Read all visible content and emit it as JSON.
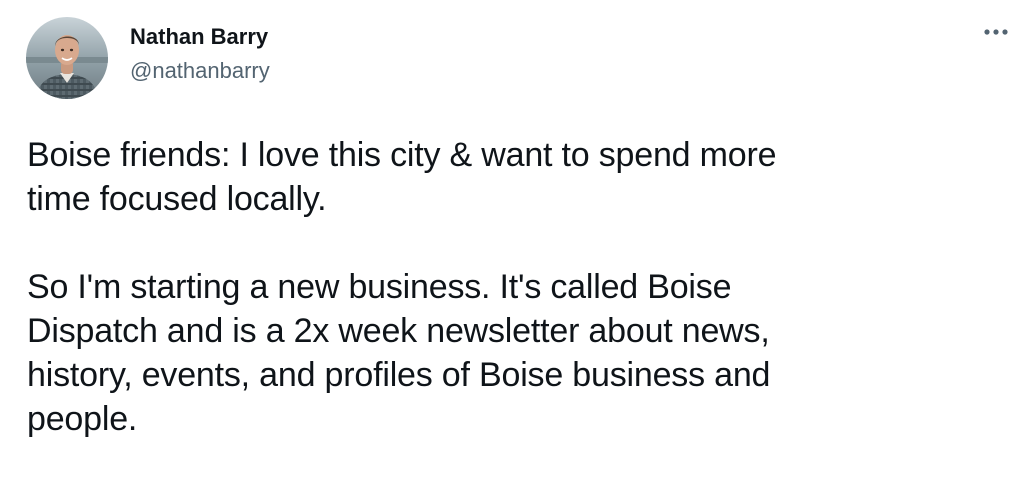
{
  "tweet": {
    "author": {
      "display_name": "Nathan Barry",
      "handle": "@nathanbarry",
      "avatar_icon": "profile-photo"
    },
    "more_icon": "more-horizontal-icon",
    "paragraphs": [
      "Boise friends: I love this city & want to spend more\ntime focused locally.",
      "So I'm starting a new business. It's called Boise\nDispatch and is a 2x week newsletter about news,\nhistory, events, and profiles of Boise business and\npeople."
    ]
  }
}
